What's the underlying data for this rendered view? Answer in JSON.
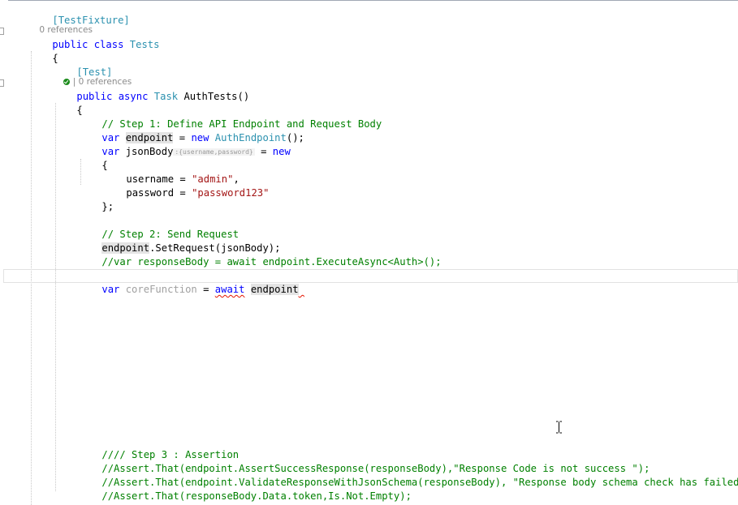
{
  "editor": {
    "lines": {
      "l1": "[TestFixture]",
      "l2_kw": "public class",
      "l2_type": "Tests",
      "l3": "{",
      "l4": "[Test]",
      "l5_kw": "public async",
      "l5_type": "Task",
      "l5_rest": "AuthTests()",
      "l6": "{",
      "l7": "// Step 1: Define API Endpoint and Request Body",
      "l8_var": "var",
      "l8_id": "endpoint",
      "l8_eq": " = ",
      "l8_new": "new",
      "l8_type": "AuthEndpoint",
      "l8_end": "();",
      "l9_var": "var",
      "l9_id": " jsonBody",
      "l9_hint": ":{username,password}",
      "l9_eq": " = ",
      "l9_new": "new",
      "l10": "{",
      "l11_key": "username = ",
      "l11_val": "\"admin\"",
      "l11_end": ",",
      "l12_key": "password = ",
      "l12_val": "\"password123\"",
      "l13": "};",
      "l14": "// Step 2: Send Request",
      "l15_id": "endpoint",
      "l15_rest": ".SetRequest(jsonBody);",
      "l16": "//var responseBody = await endpoint.ExecuteAsync<Auth>();",
      "l17_var": "var",
      "l17_id": "coreFunction",
      "l17_eq": " = ",
      "l17_await": "await",
      "l17_sp": " ",
      "l17_ep": "endpoint",
      "l18": "//// Step 3 : Assertion",
      "l19": "//Assert.That(endpoint.AssertSuccessResponse(responseBody),\"Response Code is not success \");",
      "l20": "//Assert.That(endpoint.ValidateResponseWithJsonSchema(responseBody), \"Response body schema check has failed",
      "l21": "//Assert.That(responseBody.Data.token,Is.Not.Empty);",
      "l22": "}"
    },
    "codelens": {
      "class_refs": "0 references",
      "method_sep": "|",
      "method_refs": " 0 references",
      "test_status_icon": "test-passed-icon"
    },
    "colors": {
      "keyword": "#0000ff",
      "type": "#2b91af",
      "comment": "#008000",
      "string": "#a31515",
      "error": "#e51400"
    }
  }
}
